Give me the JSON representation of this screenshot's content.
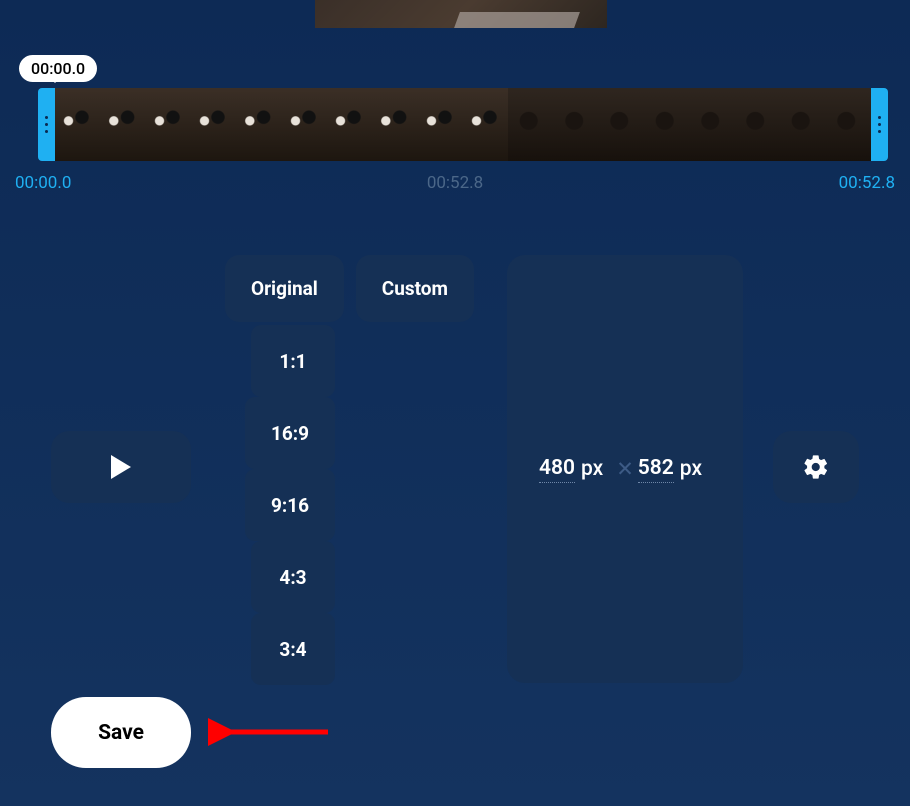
{
  "timeline": {
    "playhead_bubble": "00:00.0",
    "start_label": "00:00.0",
    "mid_label": "00:52.8",
    "end_label": "00:52.8"
  },
  "aspect_tabs": {
    "original": "Original",
    "custom": "Custom"
  },
  "ratios": {
    "r1": "1:1",
    "r2": "16:9",
    "r3": "9:16",
    "r4": "4:3",
    "r5": "3:4"
  },
  "dimensions": {
    "width_value": "480",
    "width_unit": "px",
    "separator": "✕",
    "height_value": "582",
    "height_unit": "px"
  },
  "actions": {
    "save": "Save"
  }
}
